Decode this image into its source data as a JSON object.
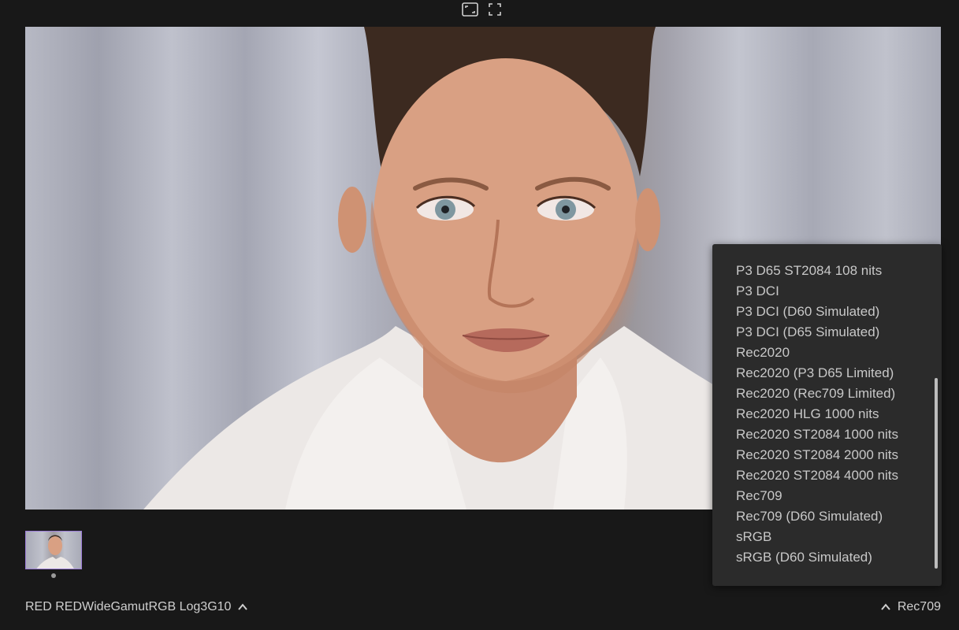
{
  "toolbar": {
    "fit_icon": "fit-frame-icon",
    "fullscreen_icon": "fullscreen-icon"
  },
  "source_colorspace": {
    "label": "RED REDWideGamutRGB Log3G10",
    "icon": "chevron-up-icon"
  },
  "output_colorspace": {
    "label": "Rec709",
    "icon": "chevron-up-icon"
  },
  "dropdown": {
    "options": [
      "P3 D65 ST2084 108 nits",
      "P3 DCI",
      "P3 DCI (D60 Simulated)",
      "P3 DCI (D65 Simulated)",
      "Rec2020",
      "Rec2020 (P3 D65 Limited)",
      "Rec2020 (Rec709 Limited)",
      "Rec2020 HLG 1000 nits",
      "Rec2020 ST2084 1000 nits",
      "Rec2020 ST2084 2000 nits",
      "Rec2020 ST2084 4000 nits",
      "Rec709",
      "Rec709 (D60 Simulated)",
      "sRGB",
      "sRGB (D60 Simulated)"
    ]
  },
  "colors": {
    "background": "#181818",
    "dropdown_bg": "#2b2b2b",
    "thumbnail_border": "#9a7bd6",
    "text": "#cfcfcf"
  }
}
